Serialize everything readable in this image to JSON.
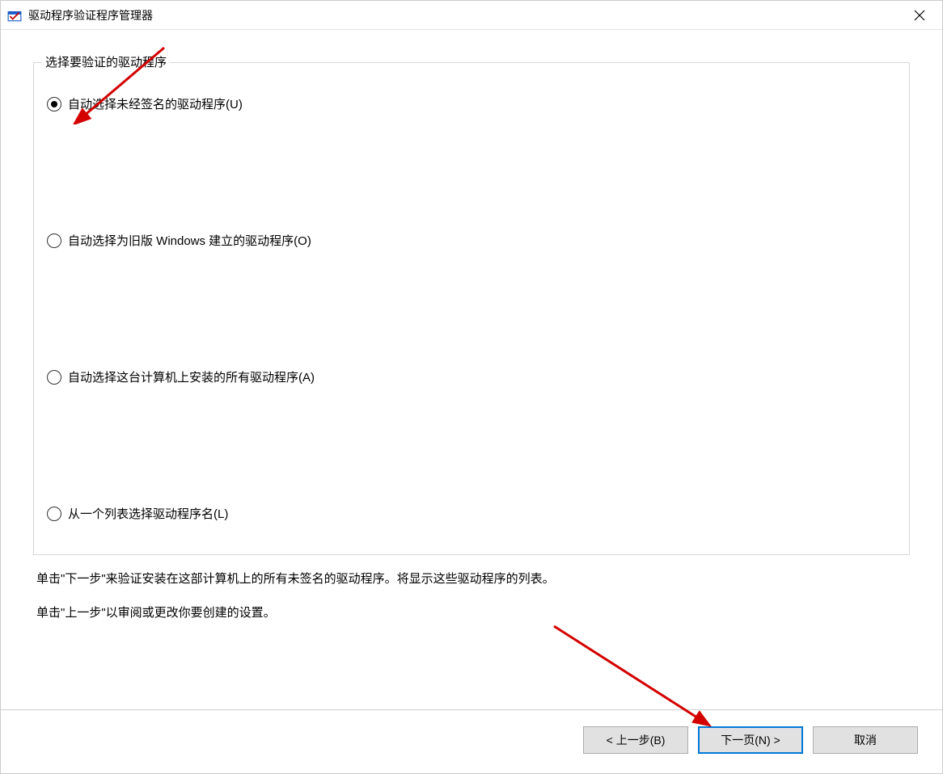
{
  "window": {
    "title": "驱动程序验证程序管理器"
  },
  "fieldset": {
    "legend": "选择要验证的驱动程序"
  },
  "radios": {
    "opt1": "自动选择未经签名的驱动程序(U)",
    "opt2": "自动选择为旧版 Windows 建立的驱动程序(O)",
    "opt3": "自动选择这台计算机上安装的所有驱动程序(A)",
    "opt4": "从一个列表选择驱动程序名(L)"
  },
  "instructions": {
    "line1": "单击\"下一步\"来验证安装在这部计算机上的所有未签名的驱动程序。将显示这些驱动程序的列表。",
    "line2": "单击\"上一步\"以审阅或更改你要创建的设置。"
  },
  "buttons": {
    "back": "< 上一步(B)",
    "next": "下一页(N) >",
    "cancel": "取消"
  }
}
